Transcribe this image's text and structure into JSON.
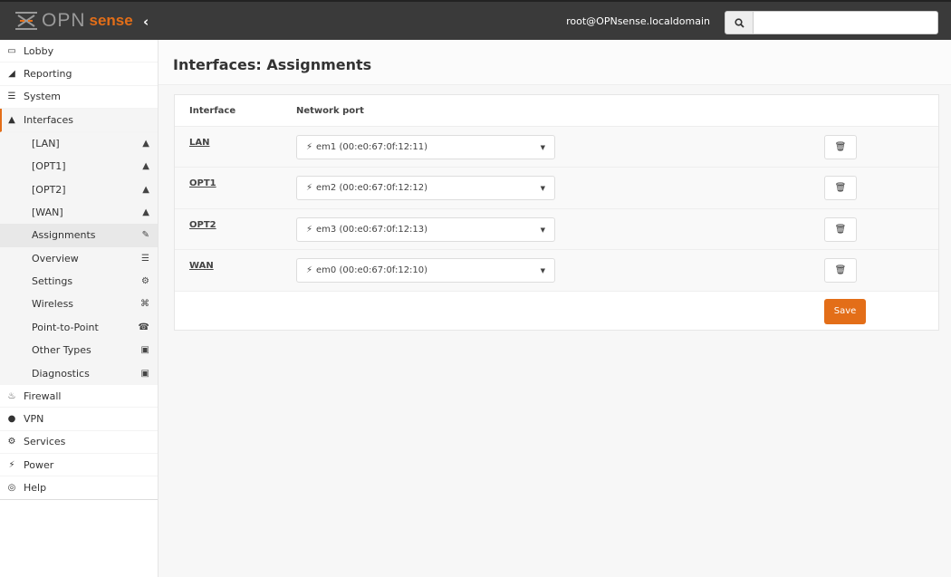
{
  "header": {
    "logo_text_opn": "OPN",
    "logo_text_sense": "sense",
    "user": "root@OPNsense.localdomain",
    "search_placeholder": ""
  },
  "sidebar": {
    "items": [
      {
        "label": "Lobby",
        "icon": "laptop-icon"
      },
      {
        "label": "Reporting",
        "icon": "area-chart-icon"
      },
      {
        "label": "System",
        "icon": "server-icon"
      },
      {
        "label": "Interfaces",
        "icon": "sitemap-icon"
      }
    ],
    "sub": [
      {
        "label": "[LAN]",
        "icon": "sitemap-icon"
      },
      {
        "label": "[OPT1]",
        "icon": "sitemap-icon"
      },
      {
        "label": "[OPT2]",
        "icon": "sitemap-icon"
      },
      {
        "label": "[WAN]",
        "icon": "sitemap-icon"
      },
      {
        "label": "Assignments",
        "icon": "pencil-icon"
      },
      {
        "label": "Overview",
        "icon": "tasks-icon"
      },
      {
        "label": "Settings",
        "icon": "cogs-icon"
      },
      {
        "label": "Wireless",
        "icon": "wifi-icon"
      },
      {
        "label": "Point-to-Point",
        "icon": "phone-icon"
      },
      {
        "label": "Other Types",
        "icon": "archive-icon"
      },
      {
        "label": "Diagnostics",
        "icon": "medkit-icon"
      }
    ],
    "bottom": [
      {
        "label": "Firewall",
        "icon": "fire-icon"
      },
      {
        "label": "VPN",
        "icon": "globe-icon"
      },
      {
        "label": "Services",
        "icon": "cog-icon"
      },
      {
        "label": "Power",
        "icon": "plug-icon"
      },
      {
        "label": "Help",
        "icon": "life-ring-icon"
      }
    ]
  },
  "page": {
    "title": "Interfaces: Assignments",
    "col_interface": "Interface",
    "col_port": "Network port",
    "save_label": "Save",
    "rows": [
      {
        "iface": "LAN",
        "port": "em1 (00:e0:67:0f:12:11)"
      },
      {
        "iface": "OPT1",
        "port": "em2 (00:e0:67:0f:12:12)"
      },
      {
        "iface": "OPT2",
        "port": "em3 (00:e0:67:0f:12:13)"
      },
      {
        "iface": "WAN",
        "port": "em0 (00:e0:67:0f:12:10)"
      }
    ]
  },
  "colors": {
    "accent": "#e36e18",
    "topbar": "#3a3a3a"
  }
}
